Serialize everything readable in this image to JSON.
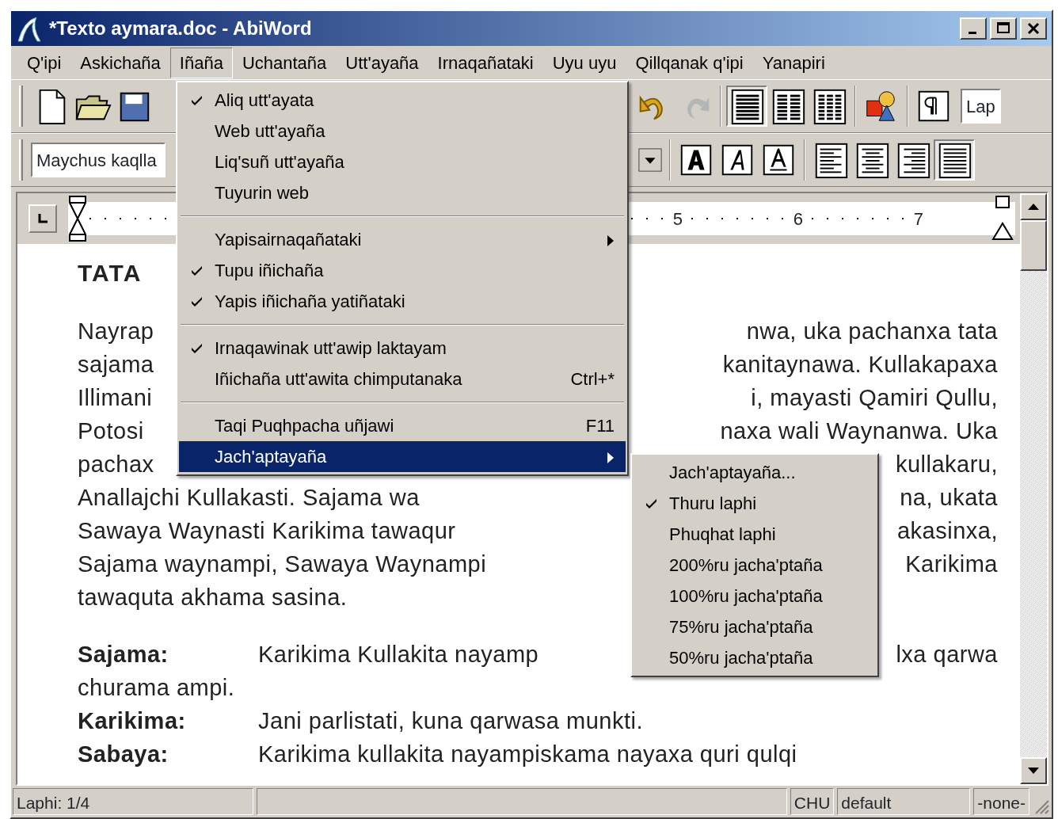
{
  "window": {
    "title": "*Texto aymara.doc - AbiWord"
  },
  "menubar": [
    {
      "label": "Q'ipi",
      "selected": false
    },
    {
      "label": "Askichaña",
      "selected": false
    },
    {
      "label": "Iñaña",
      "selected": true
    },
    {
      "label": "Uchantaña",
      "selected": false
    },
    {
      "label": "Utt'ayaña",
      "selected": false
    },
    {
      "label": "Irnaqañataki",
      "selected": false
    },
    {
      "label": "Uyu uyu",
      "selected": false
    },
    {
      "label": "Qillqanak q'ipi",
      "selected": false
    },
    {
      "label": "Yanapiri",
      "selected": false
    }
  ],
  "toolbar_1": {
    "buttons": [
      {
        "pressed": false,
        "disabled": false
      },
      {
        "pressed": false,
        "disabled": false
      },
      {
        "pressed": false,
        "disabled": false
      },
      {
        "pressed": false,
        "disabled": false
      },
      {
        "pressed": false,
        "disabled": true
      },
      {
        "pressed": true,
        "disabled": false
      },
      {
        "pressed": false,
        "disabled": false
      },
      {
        "pressed": false,
        "disabled": false
      },
      {
        "pressed": false,
        "disabled": false
      },
      {
        "pressed": false,
        "disabled": false
      }
    ],
    "zoom_field": "Lap"
  },
  "toolbar_2": {
    "style_field": "Maychus kaqlla",
    "buttons": [
      {
        "pressed": false
      },
      {
        "pressed": false
      },
      {
        "pressed": false
      },
      {
        "pressed": false
      },
      {
        "pressed": false
      },
      {
        "pressed": false
      },
      {
        "pressed": false
      },
      {
        "pressed": true
      }
    ]
  },
  "ruler": {
    "labels": [
      "5",
      "6",
      "7"
    ]
  },
  "document": {
    "title": "TATA",
    "paragraph": [
      {
        "left": "Nayrap",
        "right": "nwa, uka pachanxa tata"
      },
      {
        "left": "sajama",
        "right": "kanitaynawa. Kullakapaxa"
      },
      {
        "left": "Illimani",
        "right": "i, mayasti Qamiri Qullu,"
      },
      {
        "left": "Potosi",
        "right": "naxa wali Waynanwa. Uka"
      },
      {
        "left": "pachax",
        "right": "kullakaru,"
      },
      {
        "left": "Anallajchi Kullakasti. Sajama wa",
        "right": "na, ukata"
      },
      {
        "left": "Sawaya Waynasti Karikima tawaqur",
        "right": "akasinxa,"
      },
      {
        "left": "Sajama waynampi, Sawaya Waynampi",
        "right": "Karikima"
      },
      {
        "left": "tawaquta akhama sasina."
      }
    ],
    "dialogue": [
      {
        "speaker": "Sajama:",
        "left": "Karikima Kullakita nayamp",
        "right": "lxa qarwa"
      },
      {
        "left": "churama ampi."
      },
      {
        "speaker": "Karikima:",
        "left": "Jani parlistati, kuna qarwasa munkti."
      },
      {
        "speaker": "Sabaya:",
        "left": "Karikima kullakita nayampiskama nayaxa quri qulqi"
      }
    ]
  },
  "menu": [
    {
      "kind": "item",
      "label": "Aliq utt'ayata",
      "checked": true,
      "arrow": false,
      "selected": false
    },
    {
      "kind": "item",
      "label": "Web utt'ayaña",
      "checked": false,
      "arrow": false,
      "selected": false
    },
    {
      "kind": "item",
      "label": "Liq'suñ utt'ayaña",
      "checked": false,
      "arrow": false,
      "selected": false
    },
    {
      "kind": "item",
      "label": "Tuyurin  web",
      "checked": false,
      "arrow": false,
      "selected": false
    },
    {
      "kind": "separator"
    },
    {
      "kind": "item",
      "label": "Yapisairnaqañataki",
      "checked": false,
      "arrow": true,
      "selected": false
    },
    {
      "kind": "item",
      "label": "Tupu iñichaña",
      "checked": true,
      "arrow": false,
      "selected": false
    },
    {
      "kind": "item",
      "label": "Yapis iñichaña yatiñataki",
      "checked": true,
      "arrow": false,
      "selected": false
    },
    {
      "kind": "separator"
    },
    {
      "kind": "item",
      "label": "Irnaqawinak utt'awip laktayam",
      "checked": true,
      "arrow": false,
      "selected": false
    },
    {
      "kind": "item",
      "label": "Iñichaña utt'awita chimputanaka",
      "shortcut": "Ctrl+*",
      "checked": false,
      "arrow": false,
      "selected": false
    },
    {
      "kind": "separator"
    },
    {
      "kind": "item",
      "label": "Taqi Puqhpacha uñjawi",
      "shortcut": "F11",
      "checked": false,
      "arrow": false,
      "selected": false
    },
    {
      "kind": "item",
      "label": "Jach'aptayaña",
      "checked": false,
      "arrow": true,
      "selected": true
    }
  ],
  "submenu": [
    {
      "label": "Jach'aptayaña...",
      "checked": false
    },
    {
      "label": "Thuru laphi",
      "checked": true
    },
    {
      "label": "Phuqhat laphi",
      "checked": false
    },
    {
      "label": "200%ru jacha'ptaña",
      "checked": false
    },
    {
      "label": "100%ru jacha'ptaña",
      "checked": false
    },
    {
      "label": "75%ru jacha'ptaña",
      "checked": false
    },
    {
      "label": "50%ru jacha'ptaña",
      "checked": false
    }
  ],
  "status_bar": {
    "page": "Laphi: 1/4",
    "language": "CHU",
    "style": "default",
    "field_4": "-none-"
  }
}
